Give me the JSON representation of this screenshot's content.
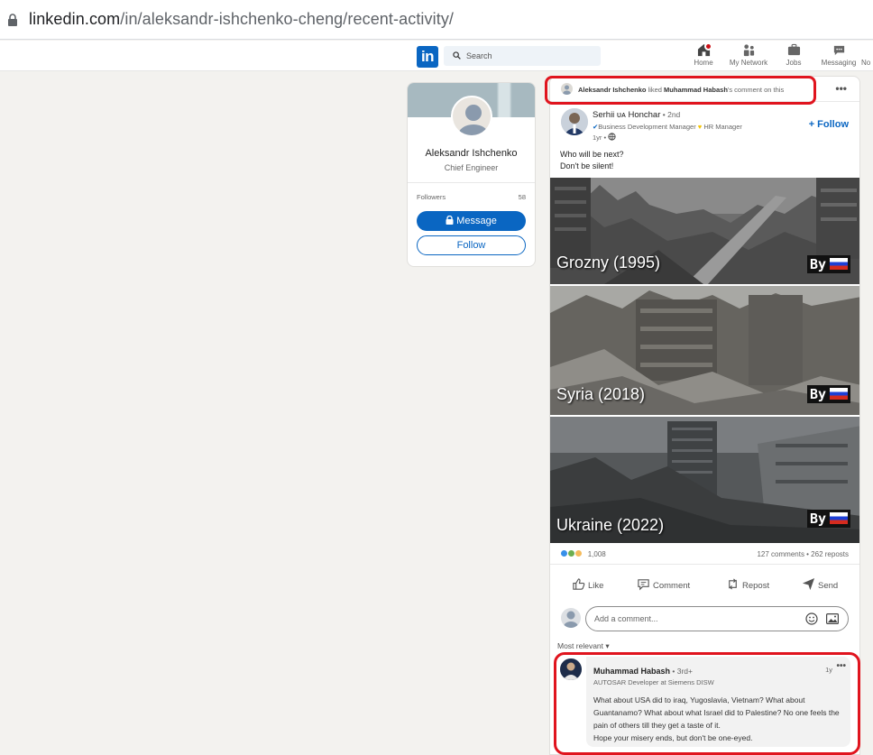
{
  "browser": {
    "url_host": "linkedin.com",
    "url_path": "/in/aleksandr-ishchenko-cheng/recent-activity/"
  },
  "nav": {
    "logo": "in",
    "search_placeholder": "Search",
    "items": [
      {
        "label": "Home",
        "icon": "home-icon"
      },
      {
        "label": "My Network",
        "icon": "network-icon"
      },
      {
        "label": "Jobs",
        "icon": "briefcase-icon"
      },
      {
        "label": "Messaging",
        "icon": "messaging-icon"
      },
      {
        "label": "No",
        "icon": "bell-icon"
      }
    ]
  },
  "profile": {
    "name": "Aleksandr Ishchenko",
    "title": "Chief Engineer",
    "followers_label": "Followers",
    "followers_count": "58",
    "message_label": "Message",
    "follow_label": "Follow"
  },
  "activity": {
    "actor": "Aleksandr Ishchenko",
    "verb": " liked ",
    "target": "Muhammad Habash",
    "suffix": "'s comment on this"
  },
  "post": {
    "author": "Serhii ᴜᴀ Honchar",
    "degree": " • 2nd",
    "subtitle_a": "Business Development Manager",
    "subtitle_b": "HR Manager",
    "time": "1yr •",
    "follow_label": "+ Follow",
    "text_line1": "Who will be next?",
    "text_line2": "Don't be silent!",
    "images": [
      {
        "caption": "Grozny (1995)",
        "by": "By"
      },
      {
        "caption": "Syria (2018)",
        "by": "By"
      },
      {
        "caption": "Ukraine (2022)",
        "by": "By"
      }
    ],
    "reactions_count": "1,008",
    "counts": "127 comments • 262 reposts",
    "actions": {
      "like": "Like",
      "comment": "Comment",
      "repost": "Repost",
      "send": "Send"
    },
    "comment_placeholder": "Add a comment...",
    "sort_label": "Most relevant ▾"
  },
  "comment": {
    "name": "Muhammad Habash",
    "degree": " • 3rd+",
    "subtitle": "AUTOSAR Developer at Siemens DISW",
    "time": "1y",
    "text_p1": "What about USA did to iraq, Yugoslavia, Vietnam? What about Guantanamo? What about what Israel did to Palestine? No one feels the pain of others till they get a taste of it.",
    "text_p2": "Hope your misery ends, but don't be one-eyed."
  },
  "colors": {
    "linkedin_blue": "#0a66c2",
    "annotation_red": "#e0141e",
    "page_bg": "#f3f2ef"
  }
}
